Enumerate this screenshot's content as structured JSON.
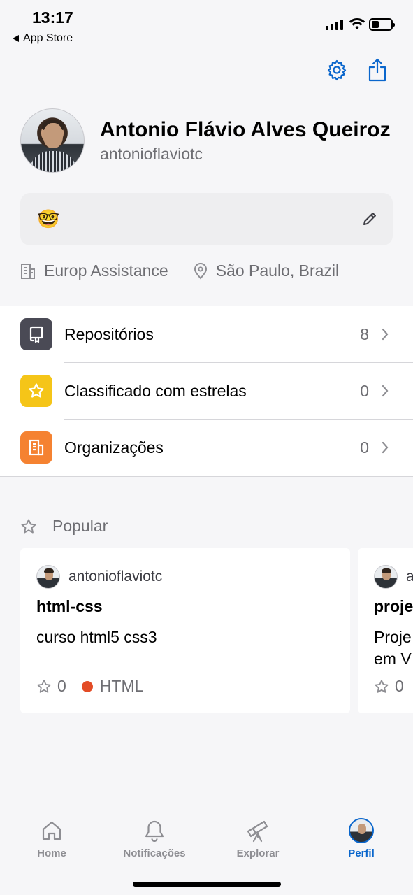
{
  "status_bar": {
    "time": "13:17",
    "back_app": "App Store"
  },
  "header": {
    "icons": [
      "gear-icon",
      "share-icon"
    ]
  },
  "profile": {
    "name": "Antonio Flávio Alves Queiroz",
    "login": "antonioflaviotc",
    "bio_emoji": "🤓",
    "company": "Europ Assistance",
    "location": "São Paulo, Brazil"
  },
  "menu": [
    {
      "label": "Repositórios",
      "count": "8",
      "icon": "repo-icon",
      "color": "#4a4a55"
    },
    {
      "label": "Classificado com estrelas",
      "count": "0",
      "icon": "star-icon",
      "color": "#f5c518"
    },
    {
      "label": "Organizações",
      "count": "0",
      "icon": "building-icon",
      "color": "#f58231"
    }
  ],
  "popular": {
    "heading": "Popular",
    "cards": [
      {
        "owner": "antonioflaviotc",
        "title": "html-css",
        "description": "curso html5 css3",
        "stars": "0",
        "language": "HTML",
        "language_color": "#e34c26"
      },
      {
        "owner": "a",
        "title": "proje",
        "description": "Proje",
        "description_line2": "em V",
        "stars": "0"
      }
    ]
  },
  "tabbar": {
    "tabs": [
      {
        "label": "Home",
        "icon": "home-icon"
      },
      {
        "label": "Notificações",
        "icon": "bell-icon"
      },
      {
        "label": "Explorar",
        "icon": "telescope-icon"
      },
      {
        "label": "Perfil",
        "icon": "avatar",
        "active": true
      }
    ]
  },
  "colors": {
    "accent": "#0a66cc",
    "background": "#f6f6f8"
  }
}
